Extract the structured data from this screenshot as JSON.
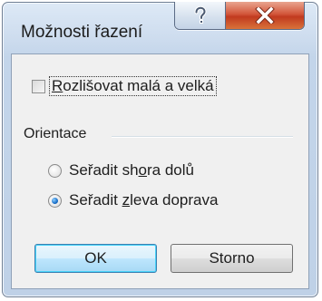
{
  "dialog": {
    "title": "Možnosti řazení",
    "help_icon": "question-mark-icon",
    "close_icon": "close-x-icon"
  },
  "case_sensitive": {
    "label_underlined": "R",
    "label_rest": "ozlišovat malá a velká",
    "checked": false
  },
  "orientation": {
    "group_label": "Orientace",
    "options": [
      {
        "label_pre": "Seřadit sh",
        "label_underlined": "o",
        "label_post": "ra dolů",
        "checked": false
      },
      {
        "label_pre": "Seřadit ",
        "label_underlined": "z",
        "label_post": "leva doprava",
        "checked": true
      }
    ]
  },
  "buttons": {
    "ok": "OK",
    "cancel": "Storno"
  }
}
